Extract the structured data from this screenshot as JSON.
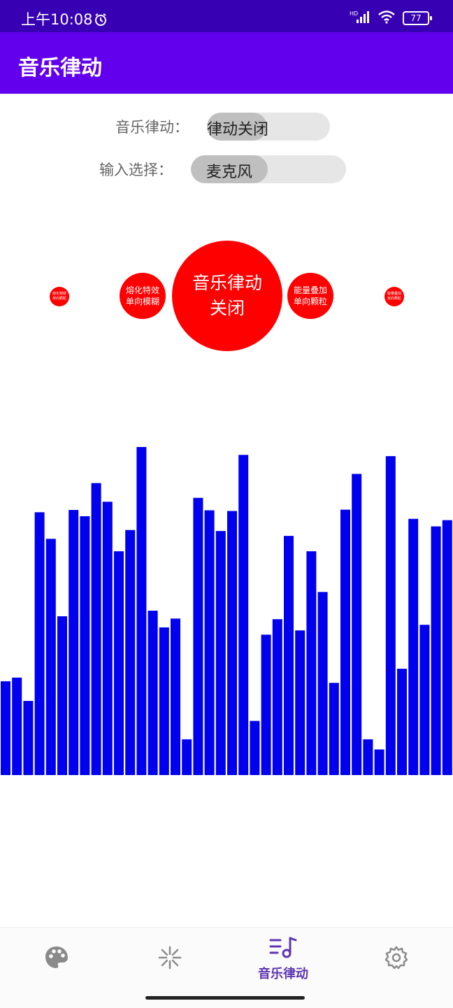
{
  "status_bar": {
    "time": "上午10:08",
    "network": "HD",
    "battery": "77"
  },
  "app_bar": {
    "title": "音乐律动"
  },
  "controls": {
    "rhythm": {
      "label": "音乐律动：",
      "value": "律动关闭"
    },
    "input": {
      "label": "输入选择：",
      "value": "麦克风"
    }
  },
  "carousel": {
    "far_left": {
      "line1": "熔化特效",
      "line2": "单向颗粒"
    },
    "left": {
      "line1": "熔化特效",
      "line2": "单向模糊"
    },
    "center": {
      "line1": "音乐律动",
      "line2": "关闭"
    },
    "right": {
      "line1": "能量叠加",
      "line2": "单向颗粒"
    },
    "far_right": {
      "line1": "能量叠加",
      "line2": "双向颗粒"
    }
  },
  "spectrum": {
    "color": "#0000ee",
    "max": 1.0,
    "levels": [
      0.286,
      0.297,
      0.226,
      0.801,
      0.72,
      0.484,
      0.808,
      0.789,
      0.89,
      0.833,
      0.682,
      0.747,
      1.0,
      0.501,
      0.45,
      0.477,
      0.109,
      0.845,
      0.807,
      0.744,
      0.805,
      0.976,
      0.165,
      0.428,
      0.475,
      0.729,
      0.441,
      0.682,
      0.558,
      0.281,
      0.809,
      0.918,
      0.109,
      0.078,
      0.972,
      0.324,
      0.781,
      0.458,
      0.758,
      0.777
    ]
  },
  "bottom_nav": {
    "items": [
      {
        "icon": "palette-icon",
        "label": ""
      },
      {
        "icon": "sparkle-icon",
        "label": ""
      },
      {
        "icon": "music-rhythm-icon",
        "label": "音乐律动"
      },
      {
        "icon": "gear-icon",
        "label": ""
      }
    ]
  },
  "colors": {
    "status_bar": "#3700b3",
    "app_bar": "#6200ee",
    "accent": "#5e35b1",
    "ball": "#ff0000",
    "bars": "#0000ee"
  }
}
